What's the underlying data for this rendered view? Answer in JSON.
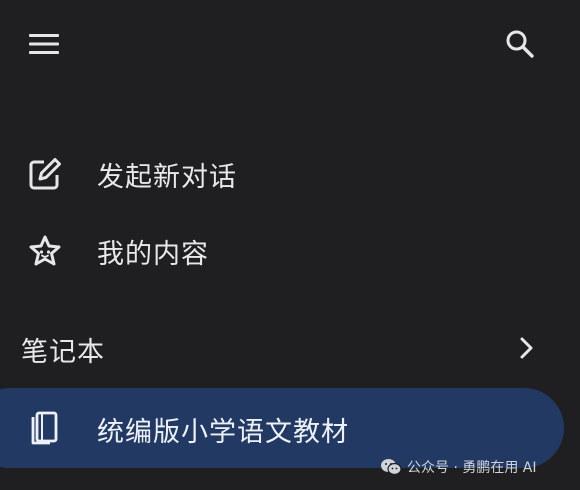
{
  "header": {
    "menu_icon": "hamburger-menu-icon",
    "search_icon": "search-icon"
  },
  "nav": {
    "items": [
      {
        "label": "发起新对话",
        "icon": "edit-icon"
      },
      {
        "label": "我的内容",
        "icon": "star-face-icon"
      }
    ]
  },
  "notebooks": {
    "title": "笔记本",
    "chevron_icon": "chevron-right-icon",
    "items": [
      {
        "label": "统编版小学语文教材",
        "icon": "notebook-icon",
        "selected": true
      }
    ]
  },
  "watermark": {
    "text": "公众号 · 勇鹏在用 AI",
    "icon": "wechat-icon"
  },
  "colors": {
    "background": "#1f1f21",
    "selected_background": "#223a63",
    "text": "#e8e8ea"
  }
}
